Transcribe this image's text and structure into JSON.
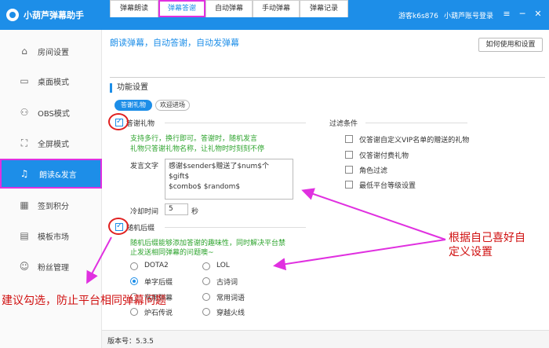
{
  "titlebar": {
    "app_title": "小葫芦弹幕助手",
    "guest": "游客k6s876",
    "login": "小葫芦账号登录",
    "menu_icon": "≡",
    "min_icon": "─",
    "close_icon": "✕"
  },
  "sidebar": {
    "items": [
      {
        "label": "房间设置",
        "icon": "⌂"
      },
      {
        "label": "桌面模式",
        "icon": "▭"
      },
      {
        "label": "OBS模式",
        "icon": "⚇"
      },
      {
        "label": "全屏模式",
        "icon": "⛶"
      },
      {
        "label": "朗读&发言",
        "icon": "♫"
      },
      {
        "label": "签到积分",
        "icon": "▦"
      },
      {
        "label": "模板市场",
        "icon": "▤"
      },
      {
        "label": "粉丝管理",
        "icon": "☺"
      }
    ],
    "active_index": 4
  },
  "main": {
    "title": "朗读弹幕，自动答谢，自动发弹幕",
    "help_button": "如何使用和设置",
    "tabs": [
      "弹幕朗读",
      "弹幕答谢",
      "自动弹幕",
      "手动弹幕",
      "弹幕记录"
    ],
    "active_tab": 1,
    "section_title": "功能设置",
    "pill_on": "答谢礼物",
    "pill_off": "欢迎进场"
  },
  "gift": {
    "checkbox_label": "答谢礼物",
    "checked": true,
    "hint_line1": "支持多行，换行即可。答谢时，随机发言",
    "hint_line2": "礼物只答谢礼物名称，让礼物时时刻刻不停",
    "speech_label": "发言文字",
    "speech_line1": "感谢$sender$赠送了$num$个$gift$",
    "speech_line2": "$combo$ $random$",
    "cooldown_label": "冷却时间",
    "cooldown_value": "5",
    "cooldown_unit": "秒"
  },
  "filters": {
    "title": "过滤条件",
    "items": [
      {
        "label": "仅答谢自定义VIP名单的赠送的礼物",
        "checked": false
      },
      {
        "label": "仅答谢付费礼物",
        "checked": false
      },
      {
        "label": "角色过滤",
        "checked": false
      },
      {
        "label": "最低平台等级设置",
        "checked": false
      }
    ]
  },
  "suffix": {
    "checkbox_label": "随机后缀",
    "checked": true,
    "hint_line1": "随机后缀能够添加答谢的趣味性，同时解决平台禁",
    "hint_line2": "止发送相同弹幕的问题噢~",
    "options": [
      {
        "label": "DOTA2",
        "checked": false
      },
      {
        "label": "LOL",
        "checked": false
      },
      {
        "label": "单字后缀",
        "checked": true
      },
      {
        "label": "古诗词",
        "checked": false
      },
      {
        "label": "常用弹幕",
        "checked": false
      },
      {
        "label": "常用词语",
        "checked": false
      },
      {
        "label": "炉石传说",
        "checked": false
      },
      {
        "label": "穿越火线",
        "checked": false
      }
    ]
  },
  "footer": {
    "version_label": "版本号：5.3.5"
  },
  "annotations": {
    "right_note_line1": "根据自己喜好自",
    "right_note_line2": "定义设置",
    "bottom_note": "建议勾选，防止平台相同弹幕问题",
    "color": "#e030e0"
  }
}
